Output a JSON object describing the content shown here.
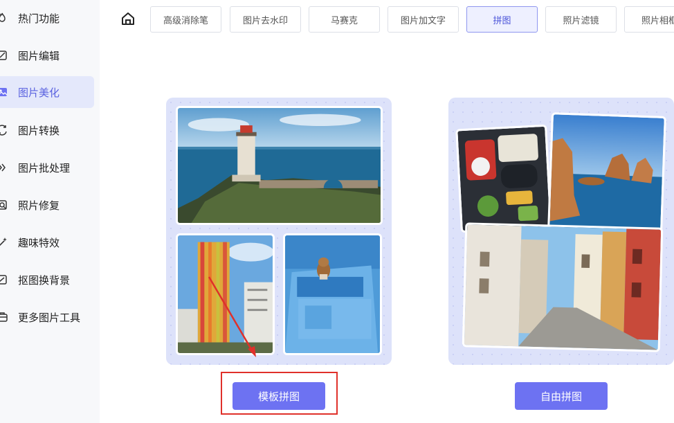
{
  "sidebar": {
    "items": [
      {
        "label": "热门功能",
        "icon": "fire-icon"
      },
      {
        "label": "图片编辑",
        "icon": "image-edit-icon"
      },
      {
        "label": "图片美化",
        "icon": "image-beautify-icon",
        "active": true
      },
      {
        "label": "图片转换",
        "icon": "convert-icon"
      },
      {
        "label": "图片批处理",
        "icon": "batch-icon"
      },
      {
        "label": "照片修复",
        "icon": "photo-repair-icon"
      },
      {
        "label": "趣味特效",
        "icon": "magic-wand-icon"
      },
      {
        "label": "抠图换背景",
        "icon": "cutout-icon"
      },
      {
        "label": "更多图片工具",
        "icon": "toolbox-icon"
      }
    ]
  },
  "toolbar": {
    "home_icon": "home-icon",
    "tabs": [
      {
        "label": "高级消除笔"
      },
      {
        "label": "图片去水印"
      },
      {
        "label": "马赛克"
      },
      {
        "label": "图片加文字"
      },
      {
        "label": "拼图",
        "active": true
      },
      {
        "label": "照片滤镜"
      },
      {
        "label": "照片相框"
      }
    ]
  },
  "main": {
    "template_collage": {
      "button_label": "模板拼图"
    },
    "free_collage": {
      "button_label": "自由拼图"
    }
  },
  "colors": {
    "accent": "#6d72f2",
    "active_bg": "#e4e8fb",
    "card_bg": "#dde2fa",
    "highlight": "#e0302a"
  }
}
